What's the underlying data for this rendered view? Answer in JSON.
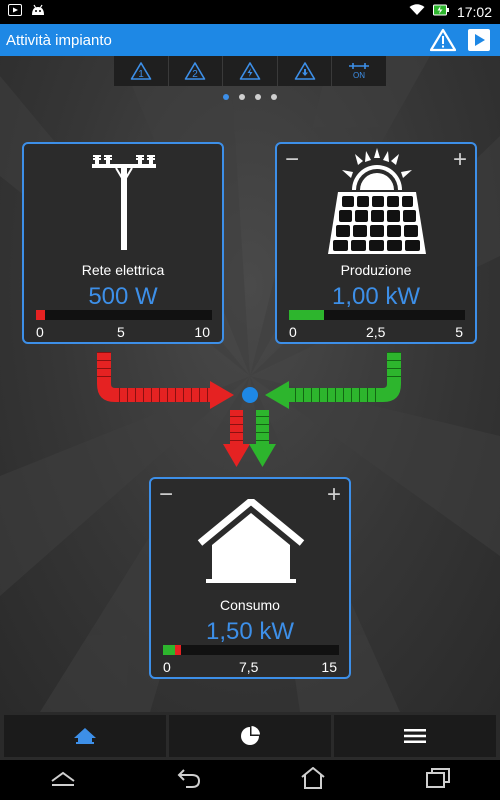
{
  "status_bar": {
    "time": "17:02"
  },
  "action_bar": {
    "title": "Attività impianto"
  },
  "toolbar": {
    "items": [
      {
        "label": "1"
      },
      {
        "label": "2"
      },
      {
        "label": ""
      },
      {
        "label": ""
      },
      {
        "label": "ON"
      }
    ]
  },
  "pager": {
    "pages": 4,
    "active": 1
  },
  "grid": {
    "name": "Rete elettrica",
    "value": "500 W",
    "scale": [
      "0",
      "5",
      "10"
    ],
    "level_fraction": 0.05
  },
  "production": {
    "name": "Produzione",
    "value": "1,00 kW",
    "scale": [
      "0",
      "2,5",
      "5"
    ],
    "level_fraction": 0.2,
    "minus": "−",
    "plus": "+"
  },
  "consumption": {
    "name": "Consumo",
    "value": "1,50 kW",
    "scale": [
      "0",
      "7,5",
      "15"
    ],
    "green_fraction": 0.067,
    "red_fraction": 0.033,
    "minus": "−",
    "plus": "+"
  },
  "colors": {
    "accent": "#3d8fe8",
    "grid_flow": "#e52222",
    "solar_flow": "#2db52d"
  },
  "icons": {
    "tab_home": "home-icon",
    "tab_stats": "pie-chart-icon",
    "tab_menu": "menu-icon"
  }
}
